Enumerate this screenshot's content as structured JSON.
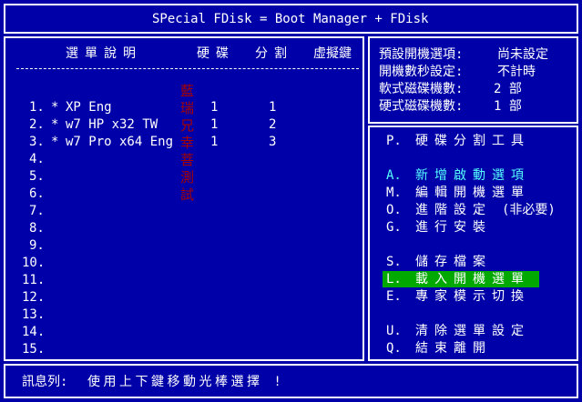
{
  "title": "SPecial FDisk = Boot Manager + FDisk",
  "left": {
    "headers": {
      "desc": "選單說明",
      "disk": "硬碟",
      "part": "分割",
      "hotkey": "虛擬鍵"
    },
    "rows": [
      {
        "num": "1.",
        "mark": "*",
        "name": "XP Eng",
        "disk": "1",
        "part": "1"
      },
      {
        "num": "2.",
        "mark": "*",
        "name": "w7 HP x32 TW",
        "disk": "1",
        "part": "2"
      },
      {
        "num": "3.",
        "mark": "*",
        "name": "w7 Pro x64 Eng",
        "disk": "1",
        "part": "3"
      },
      {
        "num": "4."
      },
      {
        "num": "5."
      },
      {
        "num": "6."
      },
      {
        "num": "7."
      },
      {
        "num": "8."
      },
      {
        "num": "9."
      },
      {
        "num": "10."
      },
      {
        "num": "11."
      },
      {
        "num": "12."
      },
      {
        "num": "13."
      },
      {
        "num": "14."
      },
      {
        "num": "15."
      }
    ],
    "overlay_chars": [
      "藍",
      "瑞",
      "兄",
      "幸",
      "菩",
      "測",
      "試"
    ]
  },
  "settings": {
    "items": [
      {
        "label": "預設開機選項:",
        "value": "尚未設定"
      },
      {
        "label": "開機數秒設定:",
        "value": "不計時"
      },
      {
        "label": "軟式磁碟機數:",
        "value": "2 部"
      },
      {
        "label": "硬式磁碟機數:",
        "value": "1 部"
      }
    ]
  },
  "menu": {
    "items": [
      {
        "key": "P.",
        "label": "硬碟分割工具"
      },
      {
        "key": "A.",
        "label": "新增啟動選項"
      },
      {
        "key": "M.",
        "label": "編輯開機選單"
      },
      {
        "key": "O.",
        "label": "進階設定",
        "suffix": "(非必要)"
      },
      {
        "key": "G.",
        "label": "進行安裝"
      },
      {
        "key": "S.",
        "label": "儲存檔案"
      },
      {
        "key": "L.",
        "label": "載入開機選單"
      },
      {
        "key": "E.",
        "label": "專家模示切換"
      },
      {
        "key": "U.",
        "label": "清除選單設定"
      },
      {
        "key": "Q.",
        "label": "結束離開"
      }
    ]
  },
  "status": {
    "label": "訊息列:",
    "message": "使用上下鍵移動光棒選擇 !"
  },
  "colors": {
    "background": "#0000a8",
    "text": "#ffffff",
    "highlight": "#00a800",
    "accent": "#55ffff",
    "overlay": "#a80000"
  }
}
